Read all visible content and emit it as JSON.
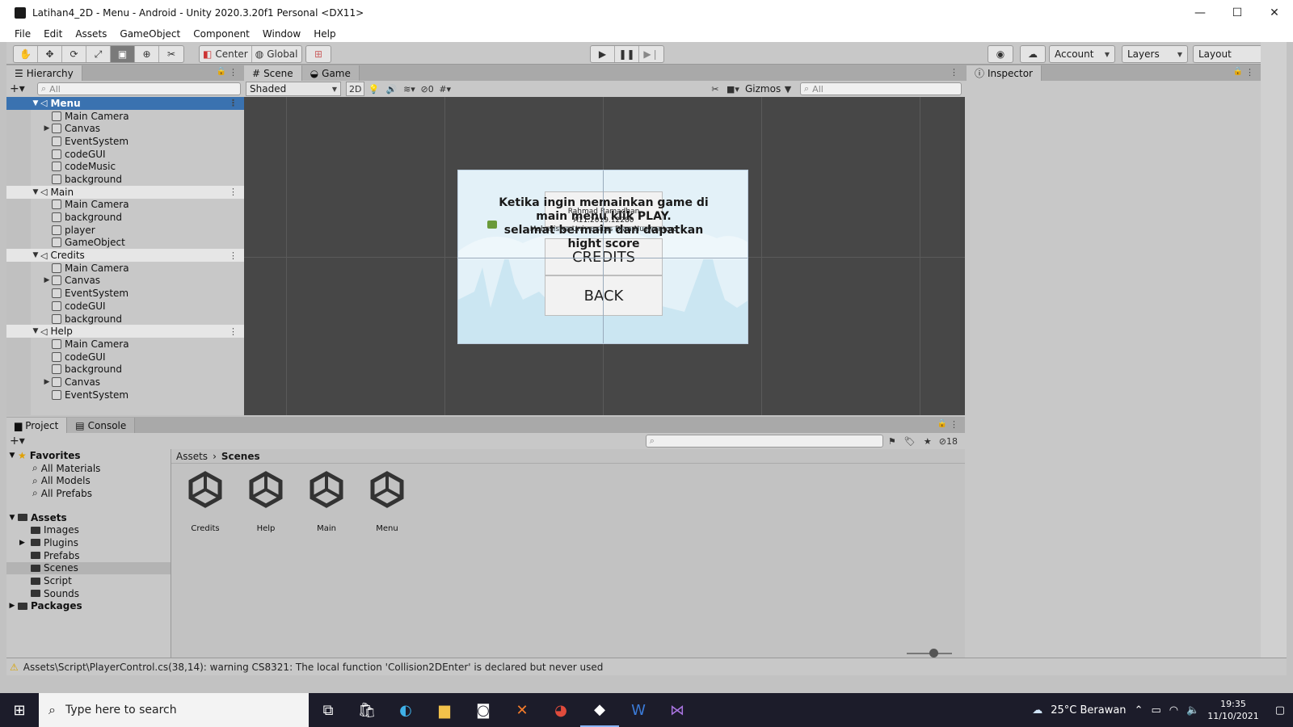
{
  "window": {
    "title": "Latihan4_2D - Menu - Android - Unity 2020.3.20f1 Personal <DX11>",
    "controls": [
      "—",
      "☐",
      "✕"
    ]
  },
  "menubar": [
    "File",
    "Edit",
    "Assets",
    "GameObject",
    "Component",
    "Window",
    "Help"
  ],
  "toolbar": {
    "pivot": "Center",
    "space": "Global",
    "account": "Account",
    "layers": "Layers",
    "layout": "Layout"
  },
  "hierarchy": {
    "tab": "Hierarchy",
    "search_placeholder": "All",
    "rows": [
      {
        "label": "Menu",
        "type": "scene",
        "selected": true
      },
      {
        "label": "Main Camera",
        "type": "object"
      },
      {
        "label": "Canvas",
        "type": "object",
        "expandable": true
      },
      {
        "label": "EventSystem",
        "type": "object"
      },
      {
        "label": "codeGUI",
        "type": "object"
      },
      {
        "label": "codeMusic",
        "type": "object"
      },
      {
        "label": "background",
        "type": "object"
      },
      {
        "label": "Main",
        "type": "scene"
      },
      {
        "label": "Main Camera",
        "type": "object"
      },
      {
        "label": "background",
        "type": "object"
      },
      {
        "label": "player",
        "type": "object"
      },
      {
        "label": "GameObject",
        "type": "object"
      },
      {
        "label": "Credits",
        "type": "scene"
      },
      {
        "label": "Main Camera",
        "type": "object"
      },
      {
        "label": "Canvas",
        "type": "object",
        "expandable": true
      },
      {
        "label": "EventSystem",
        "type": "object"
      },
      {
        "label": "codeGUI",
        "type": "object"
      },
      {
        "label": "background",
        "type": "object"
      },
      {
        "label": "Help",
        "type": "scene"
      },
      {
        "label": "Main Camera",
        "type": "object"
      },
      {
        "label": "codeGUI",
        "type": "object"
      },
      {
        "label": "background",
        "type": "object"
      },
      {
        "label": "Canvas",
        "type": "object",
        "expandable": true
      },
      {
        "label": "EventSystem",
        "type": "object"
      }
    ]
  },
  "scene": {
    "tab_scene": "Scene",
    "tab_game": "Game",
    "shading": "Shaded",
    "mode_2d": "2D",
    "hidden_count": "0",
    "gizmos": "Gizmos",
    "search_placeholder": "All",
    "game": {
      "help_text_line1": "Ketika ingin memainkan game di",
      "help_text_line2": "main menu klik PLAY.",
      "help_text_line3": "selamat bermain dan dapatkan",
      "help_text_line4": "hight score",
      "credit_name": "Rahmad Ramadhan",
      "credit_nim": "A11.2019.12280",
      "credit_univ": "Mahasiswa Universitas Dian Nuswantoro",
      "btn_credits": "CREDITS",
      "btn_back": "BACK"
    }
  },
  "inspector": {
    "tab": "Inspector"
  },
  "project": {
    "tab_project": "Project",
    "tab_console": "Console",
    "hidden_count": "18",
    "favorites": {
      "label": "Favorites",
      "items": [
        "All Materials",
        "All Models",
        "All Prefabs"
      ]
    },
    "assets": {
      "label": "Assets",
      "items": [
        {
          "label": "Images"
        },
        {
          "label": "Plugins",
          "expandable": true
        },
        {
          "label": "Prefabs"
        },
        {
          "label": "Scenes",
          "selected": true
        },
        {
          "label": "Script"
        },
        {
          "label": "Sounds"
        }
      ]
    },
    "packages": "Packages",
    "breadcrumb": [
      "Assets",
      "Scenes"
    ],
    "scenes": [
      "Credits",
      "Help",
      "Main",
      "Menu"
    ]
  },
  "status": {
    "message": "Assets\\Script\\PlayerControl.cs(38,14): warning CS8321: The local function 'Collision2DEnter' is declared but never used"
  },
  "taskbar": {
    "search_placeholder": "Type here to search",
    "weather": "25°C  Berawan",
    "time": "19:35",
    "date": "11/10/2021"
  }
}
